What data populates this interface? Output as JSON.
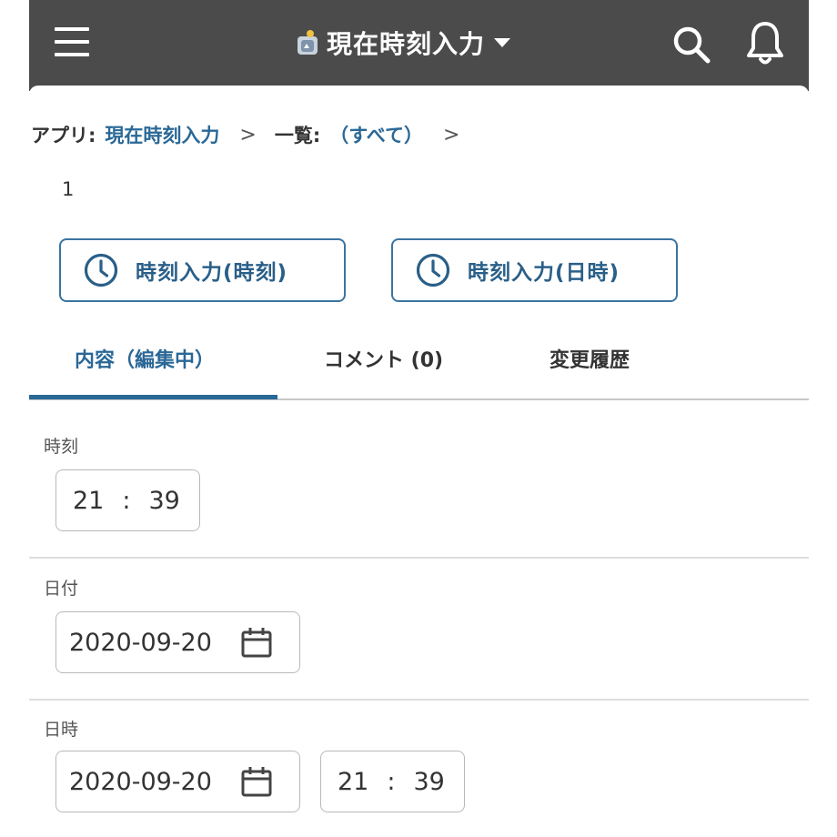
{
  "header": {
    "title": "現在時刻入力",
    "icons": [
      "menu-icon",
      "app-icon",
      "caret-down-icon",
      "search-icon",
      "bell-icon"
    ]
  },
  "breadcrumb": {
    "app_label": "アプリ:",
    "app_link": "現在時刻入力",
    "sep1": ">",
    "list_label": "一覧:",
    "list_link": "（すべて）",
    "sep2": ">"
  },
  "record": {
    "id": "1"
  },
  "actions": [
    {
      "label": "時刻入力(時刻)",
      "icon": "clock-icon"
    },
    {
      "label": "時刻入力(日時)",
      "icon": "clock-icon"
    }
  ],
  "tabs": [
    {
      "label": "内容（編集中）",
      "active": true
    },
    {
      "label": "コメント (0)",
      "active": false
    },
    {
      "label": "変更履歴",
      "active": false
    }
  ],
  "fields": {
    "time": {
      "label": "時刻",
      "hour": "21",
      "sep": ":",
      "minute": "39"
    },
    "date": {
      "label": "日付",
      "value": "2020-09-20"
    },
    "datetime": {
      "label": "日時",
      "date": "2020-09-20",
      "hour": "21",
      "sep": ":",
      "minute": "39"
    }
  },
  "colors": {
    "header_bg": "#4b4b4b",
    "accent": "#2a6896",
    "button_border": "#3a74a0",
    "input_border": "#b9b9b9"
  }
}
